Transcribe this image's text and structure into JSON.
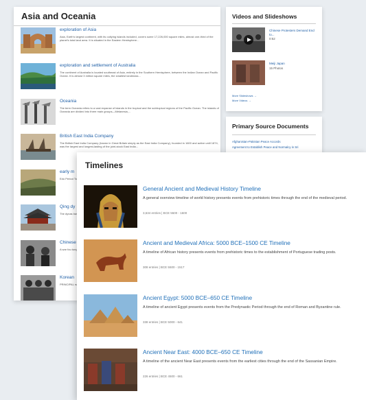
{
  "left": {
    "heading": "Asia and Oceania",
    "articles": [
      {
        "title": "exploration of Asia",
        "desc": "Asia, Earth's largest continent, with its outlying islands included, covers some 17,226,000 square miles, almost one-third of the planet's total land area. It is situated in the Eastern Hemisphere..."
      },
      {
        "title": "exploration and settlement of Australia",
        "desc": "The continent of Australia is located southeast of Asia, entirely in the Southern Hemisphere, between the Indian Ocean and Pacific Ocean. It is almost 3 million square miles, the smallest landmass..."
      },
      {
        "title": "Oceania",
        "desc": "The term Oceania refers to a vast expanse of islands in the tropical and the subtropical regions of the Pacific Ocean. The islands of Oceania are divided into three main groups—Melanesia,..."
      },
      {
        "title": "British East India Company",
        "desc": "The British East India Company (known in Great Britain simply as the East India Company), founded in 1600 and active until 1874, was the largest and longest-lasting of the joint-stock East India..."
      },
      {
        "title": "early m",
        "desc": "Edo Period Tokugaw Japan's h"
      },
      {
        "title": "Qing dy",
        "desc": "The dynas based in B sases, Th"
      },
      {
        "title": "Chinese",
        "desc": "A war fou tung) and"
      },
      {
        "title": "Korean",
        "desc": "PRINCIPAL national Republic o"
      }
    ]
  },
  "videos": {
    "heading": "Videos and Slideshows",
    "items": [
      {
        "title": "Chinese Protesters Demand End to...",
        "meta": "0:52"
      },
      {
        "title": "Meiji Japan",
        "meta": "15 Photos"
      }
    ],
    "more_slideshows": "More Slideshows →",
    "more_videos": "More Videos →"
  },
  "primary": {
    "heading": "Primary Source Documents",
    "docs": [
      "Afghanistan-Pakistan Peace Accords",
      "Agreement to Establish Peace and Normalcy in Sri"
    ]
  },
  "timelines": {
    "heading": "Timelines",
    "items": [
      {
        "title": "General Ancient and Medieval History Timeline",
        "desc": "A general overview timeline of world history presents events from prehistoric times through the end of the medieval period.",
        "meta": "3,634 entries | BCE 5500 - 1600"
      },
      {
        "title": "Ancient and Medieval Africa: 5000 BCE–1500 CE Timeline",
        "desc": "A timeline of African history presents events from prehistoric times to the establishment of Portuguese trading posts.",
        "meta": "308 entries | BCE 5500 - 1517"
      },
      {
        "title": "Ancient Egypt: 5000 BCE–650 CE Timeline",
        "desc": "A timeline of ancient Egypt presents events from the Predynastic Period through the end of Roman and Byzantine rule.",
        "meta": "338 entries | BCE 5000 - 641"
      },
      {
        "title": "Ancient Near East: 4000 BCE–650 CE Timeline",
        "desc": "A timeline of the ancient Near East presents events from the earliest cities through the end of the Sassanian Empire.",
        "meta": "226 entries | BCE 4500 - 661"
      }
    ]
  }
}
